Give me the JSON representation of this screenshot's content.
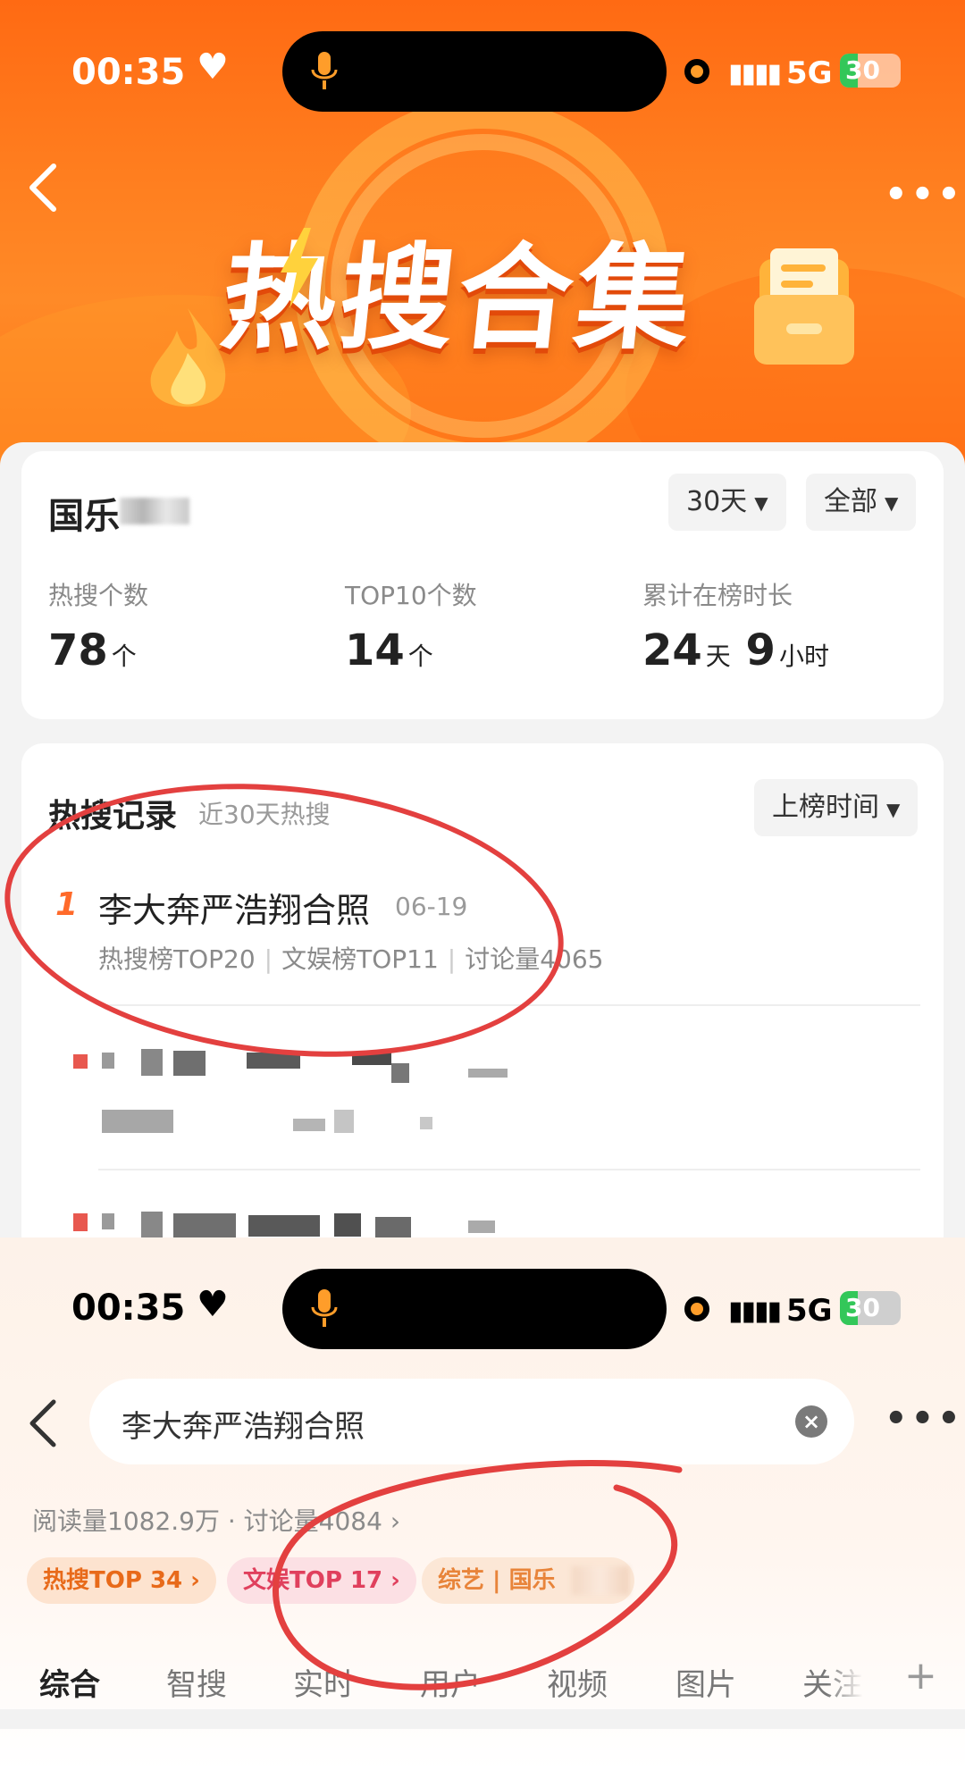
{
  "screen1": {
    "status": {
      "time": "00:35",
      "network": "5G",
      "battery": "30",
      "battery_level": 0.3
    },
    "header": {
      "banner_title": "热搜合集",
      "more": "•••"
    },
    "topic": {
      "name": "国乐",
      "range_filter": "30天",
      "scope_filter": "全部"
    },
    "stats": [
      {
        "label": "热搜个数",
        "value": "78",
        "unit": "个"
      },
      {
        "label": "TOP10个数",
        "value": "14",
        "unit": "个"
      },
      {
        "label": "累计在榜时长",
        "value": "24",
        "unit": "天",
        "value2": "9",
        "unit2": "小时"
      }
    ],
    "records": {
      "title": "热搜记录",
      "subtitle": "近30天热搜",
      "sort": "上榜时间",
      "items": [
        {
          "rank": "1",
          "title": "李大奔严浩翔合照",
          "date": "06-19",
          "meta": [
            "热搜榜TOP20",
            "文娱榜TOP11",
            "讨论量4065"
          ]
        }
      ]
    }
  },
  "screen2": {
    "status": {
      "time": "00:35",
      "network": "5G",
      "battery": "30",
      "battery_level": 0.3
    },
    "search": {
      "query": "李大奔严浩翔合照",
      "clear": "×"
    },
    "more": "•••",
    "reads": "阅读量1082.9万 · 讨论量4084 ›",
    "tags": [
      {
        "label": "热搜TOP 34 ›",
        "color": "#e86a1a",
        "bg": "#fde3cf"
      },
      {
        "label": "文娱TOP 17 ›",
        "color": "#e0405d",
        "bg": "#fce0e4"
      },
      {
        "label": "综艺 | 国乐",
        "color": "#e8843a",
        "bg": "#fce7d6"
      }
    ],
    "tabs": [
      "综合",
      "智搜",
      "实时",
      "用户",
      "视频",
      "图片",
      "关注"
    ],
    "active_tab": "综合",
    "add_tab": "+"
  }
}
